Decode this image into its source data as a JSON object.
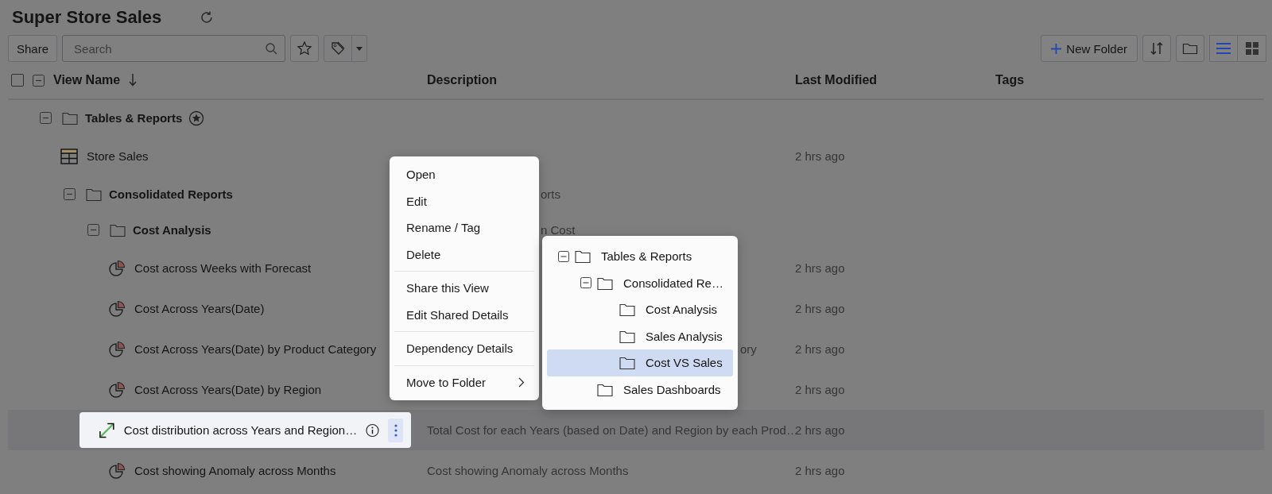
{
  "title": "Super Store Sales",
  "toolbar": {
    "share": "Share",
    "search": {
      "placeholder": "Search"
    },
    "new_folder": "New Folder",
    "views": [
      {
        "kind": "list",
        "selected": true
      },
      {
        "kind": "grid",
        "selected": false
      }
    ]
  },
  "table": {
    "select_all_checked": false,
    "columns": [
      "View Name",
      "Description",
      "Last Modified",
      "Tags"
    ],
    "rows": [
      {
        "kind": "folder",
        "name": "Tables & Reports",
        "starred": true,
        "expanded": true,
        "selected": false,
        "children": [
          {
            "kind": "table",
            "name": "Store Sales",
            "starred": false,
            "selected": false,
            "last_modified": "2 hrs ago"
          },
          {
            "kind": "folder",
            "name": "Consolidated Reports",
            "starred": false,
            "expanded": true,
            "selected": false,
            "description": "orts",
            "children": [
              {
                "kind": "folder",
                "name": "Cost Analysis",
                "starred": false,
                "expanded": true,
                "selected": false,
                "description": "n Cost",
                "children": [
                  {
                    "kind": "pie",
                    "name": "Cost across Weeks with Forecast",
                    "starred": false,
                    "selected": false,
                    "last_modified": "2 hrs ago"
                  },
                  {
                    "kind": "pie",
                    "name": "Cost Across Years(Date)",
                    "starred": false,
                    "selected": false,
                    "last_modified": "2 hrs ago"
                  },
                  {
                    "kind": "pie",
                    "name": "Cost Across Years(Date) by Product Category",
                    "starred": false,
                    "selected": false,
                    "description": "ory",
                    "last_modified": "2 hrs ago"
                  },
                  {
                    "kind": "pie",
                    "name": "Cost Across Years(Date) by Region",
                    "starred": false,
                    "selected": false,
                    "last_modified": "2 hrs ago"
                  },
                  {
                    "kind": "scatter",
                    "name": "Cost distribution across Years and Region…",
                    "starred": false,
                    "selected": true,
                    "description": "Total Cost for each Years (based on Date) and Region by each Prod…",
                    "last_modified": "2 hrs ago"
                  },
                  {
                    "kind": "pie",
                    "name": "Cost showing Anomaly across Months",
                    "starred": false,
                    "selected": false,
                    "description": "Cost showing Anomaly across Months",
                    "last_modified": "2 hrs ago"
                  }
                ]
              }
            ]
          }
        ]
      }
    ]
  },
  "context_menu": {
    "groups": [
      [
        {
          "label": "Open",
          "has_submenu": false
        },
        {
          "label": "Edit",
          "has_submenu": false
        },
        {
          "label": "Rename / Tag",
          "has_submenu": false
        },
        {
          "label": "Delete",
          "has_submenu": false
        }
      ],
      [
        {
          "label": "Share this View",
          "has_submenu": false
        },
        {
          "label": "Edit Shared Details",
          "has_submenu": false
        }
      ],
      [
        {
          "label": "Dependency Details",
          "has_submenu": false
        }
      ],
      [
        {
          "label": "Move to Folder",
          "has_submenu": true
        }
      ]
    ]
  },
  "folder_menu": {
    "folders": [
      {
        "name": "Tables & Reports",
        "expanded": true,
        "selected": false,
        "children": [
          {
            "name": "Consolidated Re…",
            "expanded": true,
            "selected": false,
            "children": [
              {
                "name": "Cost Analysis",
                "selected": false
              },
              {
                "name": "Sales Analysis",
                "selected": false
              },
              {
                "name": "Cost VS Sales",
                "selected": true
              }
            ]
          },
          {
            "name": "Sales Dashboards",
            "selected": false
          }
        ]
      }
    ]
  }
}
